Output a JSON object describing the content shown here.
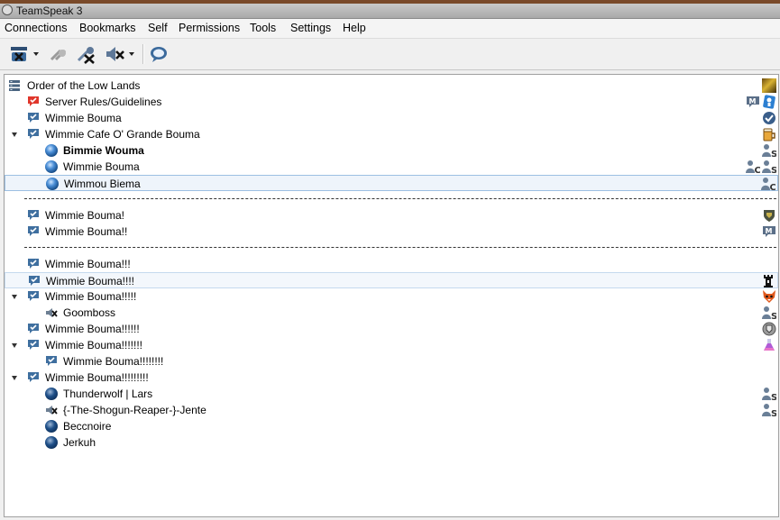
{
  "window": {
    "title": "TeamSpeak 3"
  },
  "menu": [
    {
      "label": "Connections"
    },
    {
      "label": "Bookmarks"
    },
    {
      "label": "Self"
    },
    {
      "label": "Permissions"
    },
    {
      "label": "Tools"
    },
    {
      "label": "Settings"
    },
    {
      "label": "Help"
    }
  ],
  "toolbar": {
    "buttons": [
      "connect-disconnect-icon",
      "reconnect-icon",
      "away-icon",
      "mute-speakers-icon",
      "chat-icon"
    ]
  },
  "colors": {
    "accent": "#4a8ed6",
    "selection": "#9cbfe2",
    "alert": "#e0362b"
  },
  "tree": {
    "server": {
      "label": "Order of the Low Lands",
      "right_icons": [
        "server-banner-icon"
      ]
    },
    "rows": [
      {
        "kind": "channel",
        "label": "Server Rules/Guidelines",
        "icon": "channel-alert-icon",
        "right_icons": [
          "moderated-icon",
          "info-icon"
        ]
      },
      {
        "kind": "channel",
        "label": "Wimmie Bouma",
        "icon": "channel-icon",
        "right_icons": [
          "check-icon"
        ]
      },
      {
        "kind": "channel",
        "label": "Wimmie Cafe O' Grande Bouma",
        "icon": "channel-icon",
        "expanded": true,
        "right_icons": [
          "mug-icon"
        ]
      },
      {
        "kind": "client",
        "label": "Bimmie Wouma",
        "bold": true,
        "right_icons": [
          "server-group-icon"
        ]
      },
      {
        "kind": "client",
        "label": "Wimmie Bouma",
        "right_icons": [
          "channel-commander-icon",
          "server-group-icon"
        ]
      },
      {
        "kind": "client",
        "label": "Wimmou Biema",
        "selected": true,
        "right_icons": [
          "channel-group-icon"
        ]
      },
      {
        "kind": "spacer"
      },
      {
        "kind": "channel",
        "label": "Wimmie Bouma!",
        "icon": "channel-icon",
        "right_icons": [
          "shield-icon"
        ]
      },
      {
        "kind": "channel",
        "label": "Wimmie Bouma!!",
        "icon": "channel-icon",
        "right_icons": [
          "moderated-icon"
        ]
      },
      {
        "kind": "spacer"
      },
      {
        "kind": "channel",
        "label": "Wimmie Bouma!!!",
        "icon": "channel-icon",
        "right_icons": []
      },
      {
        "kind": "channel",
        "label": "Wimmie Bouma!!!!",
        "icon": "channel-icon",
        "hover": true,
        "right_icons": [
          "tower-icon"
        ]
      },
      {
        "kind": "channel",
        "label": "Wimmie Bouma!!!!!",
        "icon": "channel-icon",
        "expanded": true,
        "right_icons": [
          "fox-icon"
        ]
      },
      {
        "kind": "client",
        "label": "Goomboss",
        "muted": true,
        "right_icons": [
          "server-group-icon"
        ]
      },
      {
        "kind": "channel",
        "label": "Wimmie Bouma!!!!!!",
        "icon": "channel-icon",
        "right_icons": [
          "crest-icon"
        ]
      },
      {
        "kind": "channel",
        "label": "Wimmie Bouma!!!!!!!",
        "icon": "channel-icon",
        "expanded": true,
        "right_icons": [
          "flask-icon"
        ]
      },
      {
        "kind": "subchannel",
        "label": "Wimmie Bouma!!!!!!!!",
        "icon": "channel-icon",
        "right_icons": []
      },
      {
        "kind": "channel",
        "label": "Wimmie Bouma!!!!!!!!!",
        "icon": "channel-icon",
        "expanded": true,
        "right_icons": []
      },
      {
        "kind": "client",
        "label": "Thunderwolf | Lars",
        "dark": true,
        "right_icons": [
          "server-group-icon"
        ]
      },
      {
        "kind": "client",
        "label": "{-The-Shogun-Reaper-}-Jente",
        "muted": true,
        "right_icons": [
          "server-group-icon"
        ]
      },
      {
        "kind": "client",
        "label": "Beccnoire",
        "dark": true,
        "right_icons": []
      },
      {
        "kind": "client",
        "label": "Jerkuh",
        "dark": true,
        "right_icons": []
      }
    ]
  }
}
